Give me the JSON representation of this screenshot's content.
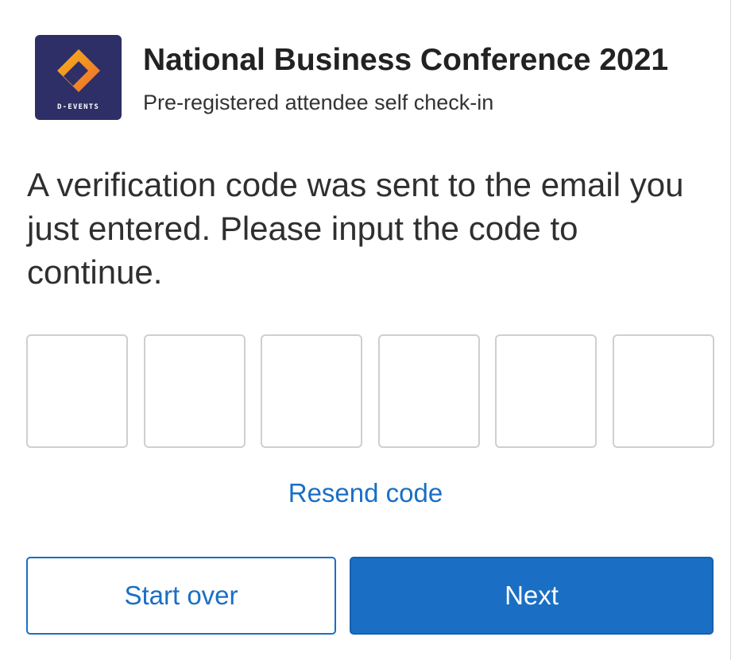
{
  "header": {
    "logo_icon": "d-events-diamond-icon",
    "logo_text": "D-EVENTS",
    "title": "National Business Conference 2021",
    "subtitle": "Pre-registered attendee self check-in"
  },
  "verification": {
    "message": "A verification code was sent to the email you just entered. Please input the code to continue.",
    "code_digits": [
      "",
      "",
      "",
      "",
      "",
      ""
    ],
    "resend_label": "Resend code"
  },
  "actions": {
    "start_over_label": "Start over",
    "next_label": "Next"
  },
  "colors": {
    "accent": "#1a6fc4",
    "logo_background": "#2e2f66",
    "logo_orange": "#f0822a",
    "logo_yellow": "#f6b41c"
  }
}
